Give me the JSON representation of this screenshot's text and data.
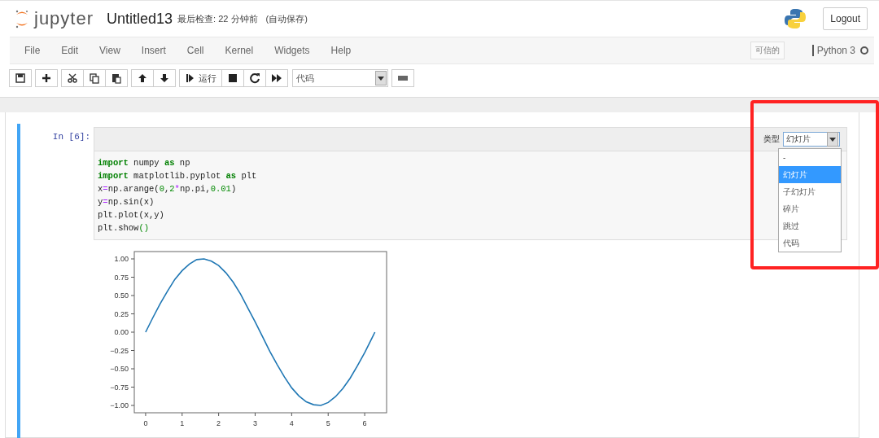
{
  "header": {
    "logo_text": "jupyter",
    "notebook_name": "Untitled13",
    "checkpoint": "最后检查: 22 分钟前",
    "autosave": "(自动保存)",
    "logout": "Logout"
  },
  "menu": [
    "File",
    "Edit",
    "View",
    "Insert",
    "Cell",
    "Kernel",
    "Widgets",
    "Help"
  ],
  "kernel": {
    "trusted": "可信的",
    "name": "Python 3",
    "busy": false
  },
  "toolbar": {
    "groups": [
      [
        {
          "kind": "save"
        }
      ],
      [
        {
          "kind": "add"
        }
      ],
      [
        {
          "kind": "cut"
        },
        {
          "kind": "copy"
        },
        {
          "kind": "paste"
        }
      ],
      [
        {
          "kind": "up"
        },
        {
          "kind": "down"
        }
      ],
      [
        {
          "kind": "run"
        },
        {
          "kind": "stop"
        },
        {
          "kind": "restart"
        },
        {
          "kind": "fast-forward"
        }
      ]
    ],
    "run_label": "运行",
    "cell_type": "代码"
  },
  "cell": {
    "prompt": "In [6]:",
    "slide_label": "类型",
    "slide_value": "幻灯片",
    "slide_options": [
      {
        "label": "-",
        "selected": false
      },
      {
        "label": "幻灯片",
        "selected": true
      },
      {
        "label": "子幻灯片",
        "selected": false
      },
      {
        "label": "碎片",
        "selected": false
      },
      {
        "label": "跳过",
        "selected": false
      },
      {
        "label": "代码",
        "selected": false
      }
    ],
    "code": [
      [
        {
          "text": "import",
          "kind": "keyword"
        },
        {
          "text": " numpy ",
          "kind": "plain"
        },
        {
          "text": "as",
          "kind": "keyword"
        },
        {
          "text": " np",
          "kind": "plain"
        }
      ],
      [
        {
          "text": "import",
          "kind": "keyword"
        },
        {
          "text": " matplotlib.pyplot ",
          "kind": "plain"
        },
        {
          "text": "as",
          "kind": "keyword"
        },
        {
          "text": " plt",
          "kind": "plain"
        }
      ],
      [
        {
          "text": "x",
          "kind": "plain"
        },
        {
          "text": "=",
          "kind": "operator"
        },
        {
          "text": "np.arange(",
          "kind": "plain"
        },
        {
          "text": "0",
          "kind": "number"
        },
        {
          "text": ",",
          "kind": "plain"
        },
        {
          "text": "2",
          "kind": "number"
        },
        {
          "text": "*",
          "kind": "operator"
        },
        {
          "text": "np.pi,",
          "kind": "plain"
        },
        {
          "text": "0.01",
          "kind": "number"
        },
        {
          "text": ")",
          "kind": "plain"
        }
      ],
      [
        {
          "text": "y",
          "kind": "plain"
        },
        {
          "text": "=",
          "kind": "operator"
        },
        {
          "text": "np.sin(x)",
          "kind": "plain"
        }
      ],
      [
        {
          "text": "plt.plot(x,y)",
          "kind": "plain"
        }
      ],
      [
        {
          "text": "plt.show",
          "kind": "plain"
        },
        {
          "text": "()",
          "kind": "paren"
        }
      ]
    ],
    "output": {
      "chart_data": {
        "type": "line",
        "x": [
          0,
          0.2,
          0.4,
          0.6,
          0.8,
          1.0,
          1.2,
          1.4,
          1.6,
          1.8,
          2.0,
          2.2,
          2.4,
          2.6,
          2.8,
          3.0,
          3.2,
          3.4,
          3.6,
          3.8,
          4.0,
          4.2,
          4.4,
          4.6,
          4.8,
          5.0,
          5.2,
          5.4,
          5.6,
          5.8,
          6.0,
          6.2,
          6.28
        ],
        "series": [
          {
            "color": "#1f77b4",
            "values": [
              0,
              0.2,
              0.39,
              0.56,
              0.72,
              0.84,
              0.93,
              0.99,
              1.0,
              0.97,
              0.91,
              0.81,
              0.68,
              0.52,
              0.33,
              0.14,
              -0.06,
              -0.26,
              -0.44,
              -0.61,
              -0.76,
              -0.87,
              -0.95,
              -0.99,
              -1.0,
              -0.96,
              -0.88,
              -0.77,
              -0.63,
              -0.46,
              -0.28,
              -0.08,
              0
            ]
          }
        ],
        "xlim": [
          -0.31,
          6.6
        ],
        "ylim": [
          -1.1,
          1.1
        ],
        "xticks": [
          {
            "value": 0,
            "label": "0"
          },
          {
            "value": 1,
            "label": "1"
          },
          {
            "value": 2,
            "label": "2"
          },
          {
            "value": 3,
            "label": "3"
          },
          {
            "value": 4,
            "label": "4"
          },
          {
            "value": 5,
            "label": "5"
          },
          {
            "value": 6,
            "label": "6"
          }
        ],
        "yticks": [
          {
            "value": 1,
            "label": "1.00"
          },
          {
            "value": 0.75,
            "label": "0.75"
          },
          {
            "value": 0.5,
            "label": "0.50"
          },
          {
            "value": 0.25,
            "label": "0.25"
          },
          {
            "value": 0,
            "label": "0.00"
          },
          {
            "value": -0.25,
            "label": "−0.25"
          },
          {
            "value": -0.5,
            "label": "−0.50"
          },
          {
            "value": -0.75,
            "label": "−0.75"
          },
          {
            "value": -1,
            "label": "−1.00"
          }
        ]
      }
    }
  }
}
